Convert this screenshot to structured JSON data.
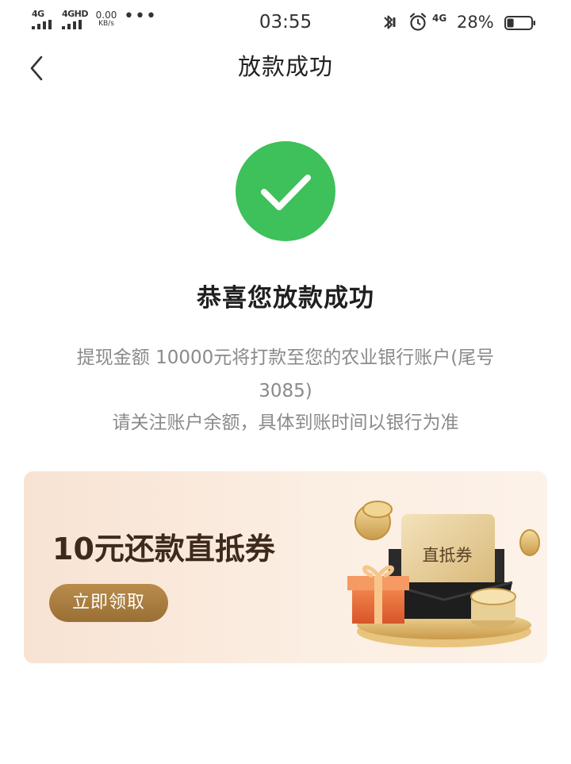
{
  "status_bar": {
    "sim1_tag": "4G",
    "sim2_tag": "4GHD",
    "speed_value": "0.00",
    "speed_unit": "KB/s",
    "more": "•••",
    "time": "03:55",
    "network_tag": "4G",
    "battery_percent": "28%",
    "battery_level": 0.28
  },
  "nav": {
    "title": "放款成功",
    "back_icon": "chevron-left-icon"
  },
  "success": {
    "icon": "check-circle-icon",
    "icon_color": "#3ec05a",
    "heading": "恭喜您放款成功",
    "line1": "提现金额 10000元将打款至您的农业银行账户(尾号",
    "line2": "3085)",
    "line3": "请关注账户余额，具体到账时间以银行为准"
  },
  "coupon": {
    "title": "10元还款直抵券",
    "button_label": "立即领取",
    "ticket_label": "直抵券",
    "accent_color": "#a87c3f"
  }
}
